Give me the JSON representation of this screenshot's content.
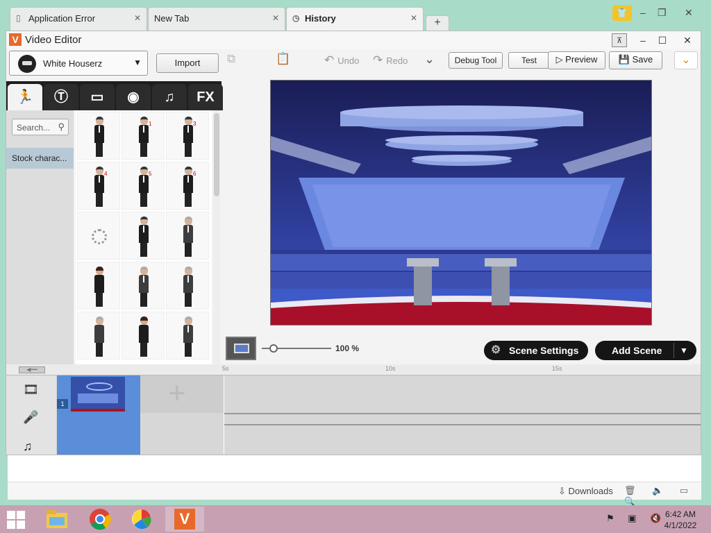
{
  "browser": {
    "tabs": [
      {
        "label": "Application Error",
        "active": false
      },
      {
        "label": "New Tab",
        "active": false
      },
      {
        "label": "History",
        "active": true
      }
    ],
    "new_tab_label": "+",
    "window_controls": {
      "minimize": "–",
      "restore": "❐",
      "close": "✕"
    },
    "status": {
      "downloads_label": "Downloads"
    }
  },
  "app": {
    "title": "Video Editor",
    "logo_letter": "V",
    "character_select": {
      "value": "White Houserz"
    },
    "import_label": "Import",
    "category_tabs": [
      {
        "name": "characters",
        "glyph": "🏃"
      },
      {
        "name": "text",
        "glyph": "T"
      },
      {
        "name": "backgrounds",
        "glyph": "▭"
      },
      {
        "name": "props",
        "glyph": "◉"
      },
      {
        "name": "music",
        "glyph": "♫"
      },
      {
        "name": "effects",
        "glyph": "FX"
      }
    ],
    "search": {
      "placeholder": "Search..."
    },
    "stock_item_label": "Stock charac...",
    "grid_labels": {
      "c2": "1",
      "c3": "3",
      "c4": "4",
      "c5": "5",
      "c6": "6"
    },
    "toolbar": {
      "undo_label": "Undo",
      "redo_label": "Redo",
      "debug_label": "Debug Tool",
      "test_label": "Test",
      "preview_label": "Preview",
      "save_label": "Save"
    },
    "zoom": {
      "percent_label": "100 %",
      "level": 0.12
    },
    "scene_settings_label": "Scene Settings",
    "add_scene_label": "Add Scene",
    "timeline": {
      "ruler_labels": [
        "5s",
        "10s",
        "15s"
      ],
      "scene_number": "1"
    }
  },
  "taskbar": {
    "time": "6:42 AM",
    "date": "4/1/2022"
  },
  "colors": {
    "accent_orange": "#e8692a",
    "stage_blue": "#1d2266",
    "stock_selected": "#b8c9d6"
  }
}
